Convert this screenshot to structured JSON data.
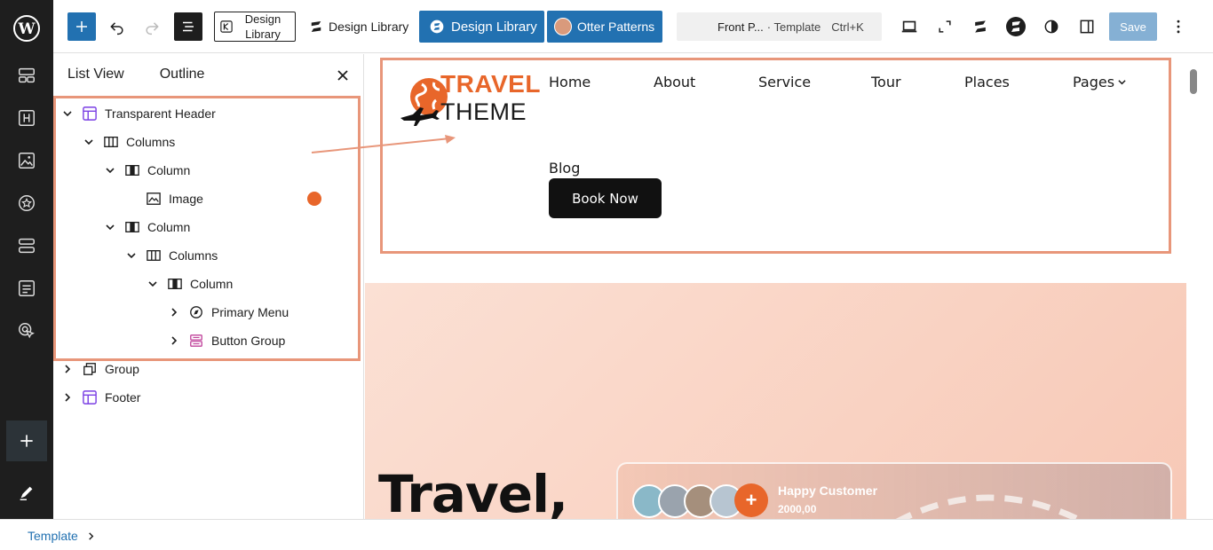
{
  "toolbar": {
    "design_library_outline": "Design Library",
    "design_library_plain": "Design Library",
    "design_library_blue": "Design Library",
    "otter_patterns": "Otter Patterns",
    "command_title": "Front P...",
    "command_type": "· Template",
    "command_shortcut": "Ctrl+K",
    "save_label": "Save"
  },
  "panel": {
    "tab_list_view": "List View",
    "tab_outline": "Outline",
    "tree": [
      {
        "label": "Transparent Header",
        "icon": "template-part-icon",
        "expanded": true,
        "depth": 0
      },
      {
        "label": "Columns",
        "icon": "columns-icon",
        "expanded": true,
        "depth": 1
      },
      {
        "label": "Column",
        "icon": "column-icon",
        "expanded": true,
        "depth": 2
      },
      {
        "label": "Image",
        "icon": "image-icon",
        "expanded": null,
        "depth": 3
      },
      {
        "label": "Column",
        "icon": "column-icon",
        "expanded": true,
        "depth": 2
      },
      {
        "label": "Columns",
        "icon": "columns-icon",
        "expanded": true,
        "depth": 3
      },
      {
        "label": "Column",
        "icon": "column-icon",
        "expanded": true,
        "depth": 4
      },
      {
        "label": "Primary Menu",
        "icon": "navigation-icon",
        "expanded": false,
        "depth": 5
      },
      {
        "label": "Button Group",
        "icon": "buttons-icon",
        "expanded": false,
        "depth": 5
      },
      {
        "label": "Group",
        "icon": "group-icon",
        "expanded": false,
        "depth": 0
      },
      {
        "label": "Footer",
        "icon": "template-part-icon",
        "expanded": false,
        "depth": 0
      }
    ]
  },
  "canvas": {
    "logo_line1": "TRAVEL",
    "logo_line2": "THEME",
    "nav": [
      "Home",
      "About",
      "Service",
      "Tour",
      "Places",
      "Pages"
    ],
    "blog": "Blog",
    "book_now": "Book Now",
    "hero_title": "Travel,",
    "happy_customer_label": "Happy Customer",
    "happy_customer_value": "2000,00"
  },
  "statusbar": {
    "breadcrumb": "Template"
  },
  "colors": {
    "accent": "#2271b1",
    "brand_orange": "#e8662a",
    "highlight": "#e8967a",
    "sidebar_bg": "#1e1e1e"
  }
}
